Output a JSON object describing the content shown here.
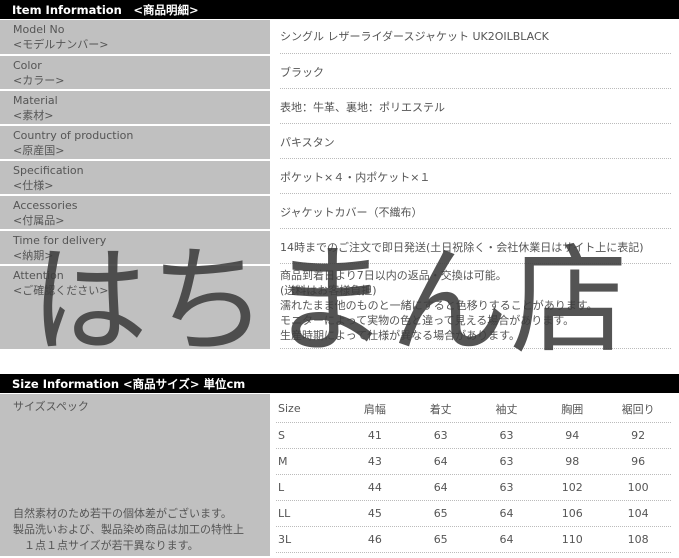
{
  "item_header": "Item Information　<商品明細>",
  "items": [
    {
      "en": "Model No",
      "jp": "<モデルナンバー>",
      "value": "シングル レザーライダースジャケット UK2OILBLACK"
    },
    {
      "en": "Color",
      "jp": "<カラー>",
      "value": "ブラック"
    },
    {
      "en": "Material",
      "jp": "<素材>",
      "value": "表地：牛革、裏地：ポリエステル"
    },
    {
      "en": "Country of production",
      "jp": "<原産国>",
      "value": "パキスタン"
    },
    {
      "en": "Specification",
      "jp": "<仕様>",
      "value": "ポケット×４・内ポケット×１"
    },
    {
      "en": "Accessories",
      "jp": "<付属品>",
      "value": "ジャケットカバー（不織布）"
    },
    {
      "en": "Time for delivery",
      "jp": "<納期>",
      "value": "14時までのご注文で即日発送(土日祝除く・会社休業日はサイト上に表記)"
    },
    {
      "en": "Attention",
      "jp": "<ご確認ください>",
      "lines": [
        "商品到着日より7日以内の返品・交換は可能。",
        "(送料はお客様負担)",
        "濡れたまま他のものと一緒にすると色移りすることがあります。",
        "モニターによって実物の色と違って見える場合があります。",
        "生産時期によって仕様が異なる場合があります。"
      ]
    }
  ],
  "size_header": "Size Information <商品サイズ> 単位cm",
  "size_label": "サイズスペック",
  "size_note": [
    "自然素材のため若干の個体差がございます。",
    "製品洗いおよび、製品染め商品は加工の特性上",
    "　１点１点サイズが若干異なります。"
  ],
  "size_table": {
    "headers": [
      "Size",
      "肩幅",
      "着丈",
      "袖丈",
      "胸囲",
      "裾回り"
    ],
    "rows": [
      [
        "S",
        "41",
        "63",
        "63",
        "94",
        "92"
      ],
      [
        "M",
        "43",
        "64",
        "63",
        "98",
        "96"
      ],
      [
        "L",
        "44",
        "64",
        "63",
        "102",
        "100"
      ],
      [
        "LL",
        "45",
        "65",
        "64",
        "106",
        "104"
      ],
      [
        "3L",
        "46",
        "65",
        "64",
        "110",
        "108"
      ]
    ]
  },
  "watermark": "はちまん店"
}
